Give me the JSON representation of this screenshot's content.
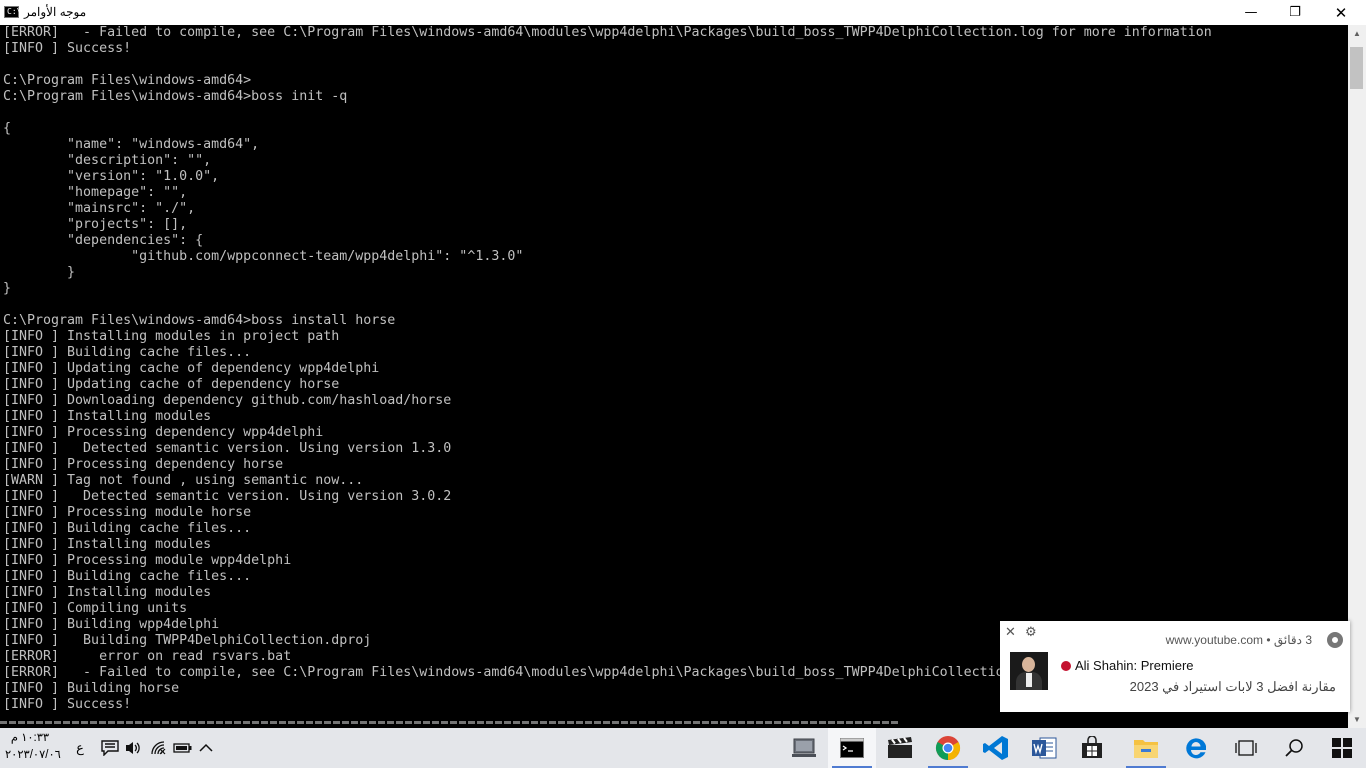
{
  "window": {
    "title": "موجه الأوامر",
    "controls": {
      "minimize": "—",
      "maximize": "❐",
      "close": "✕"
    }
  },
  "console": {
    "lines": [
      "[ERROR]   - Failed to compile, see C:\\Program Files\\windows-amd64\\modules\\wpp4delphi\\Packages\\build_boss_TWPP4DelphiCollection.log for more information",
      "[INFO ] Success!",
      "",
      "C:\\Program Files\\windows-amd64>",
      "C:\\Program Files\\windows-amd64>boss init -q",
      "",
      "{",
      "        \"name\": \"windows-amd64\",",
      "        \"description\": \"\",",
      "        \"version\": \"1.0.0\",",
      "        \"homepage\": \"\",",
      "        \"mainsrc\": \"./\",",
      "        \"projects\": [],",
      "        \"dependencies\": {",
      "                \"github.com/wppconnect-team/wpp4delphi\": \"^1.3.0\"",
      "        }",
      "}",
      "",
      "C:\\Program Files\\windows-amd64>boss install horse",
      "[INFO ] Installing modules in project path",
      "[INFO ] Building cache files...",
      "[INFO ] Updating cache of dependency wpp4delphi",
      "[INFO ] Updating cache of dependency horse",
      "[INFO ] Downloading dependency github.com/hashload/horse",
      "[INFO ] Installing modules",
      "[INFO ] Processing dependency wpp4delphi",
      "[INFO ]   Detected semantic version. Using version 1.3.0",
      "[INFO ] Processing dependency horse",
      "[WARN ] Tag not found , using semantic now...",
      "[INFO ]   Detected semantic version. Using version 3.0.2",
      "[INFO ] Processing module horse",
      "[INFO ] Building cache files...",
      "[INFO ] Installing modules",
      "[INFO ] Processing module wpp4delphi",
      "[INFO ] Building cache files...",
      "[INFO ] Installing modules",
      "[INFO ] Compiling units",
      "[INFO ] Building wpp4delphi",
      "[INFO ]   Building TWPP4DelphiCollection.dproj",
      "[ERROR]     error on read rsvars.bat",
      "[ERROR]   - Failed to compile, see C:\\Program Files\\windows-amd64\\modules\\wpp4delphi\\Packages\\build_boss_TWPP4DelphiCollection.log for more information",
      "[INFO ] Building horse",
      "[INFO ] Success!"
    ]
  },
  "notification": {
    "source": "www.youtube.com",
    "separator": "•",
    "time": "3 دقائق",
    "channel": "Ali Shahin: Premiere",
    "message": "مقارنة افضل 3 لابات استيراد في 2023",
    "icons": {
      "close": "close-icon",
      "settings": "gear-icon",
      "browser": "chrome-icon",
      "live": "live-dot"
    }
  },
  "taskbar": {
    "clock": {
      "time": "١٠:٣٣ م",
      "date": "٢٠٢٣/٠٧/٠٦"
    },
    "language": "ع",
    "tray_icons": [
      "notification-center-icon",
      "volume-icon",
      "network-icon",
      "battery-icon",
      "show-hidden-icons-icon"
    ],
    "apps": [
      "desktop-icon",
      "command-prompt-icon",
      "video-editor-icon",
      "chrome-icon",
      "vscode-icon",
      "word-icon",
      "store-icon",
      "file-explorer-icon",
      "edge-icon",
      "task-view-icon",
      "search-icon",
      "start-icon"
    ],
    "colors": {
      "chrome_red": "#db4437",
      "chrome_yellow": "#f4b400",
      "chrome_green": "#0f9d58",
      "chrome_blue": "#4285f4",
      "vscode": "#0078d4",
      "word": "#2b579a",
      "edge": "#0078d7",
      "folder": "#f5c242",
      "accent": "#4f7bd1"
    }
  }
}
